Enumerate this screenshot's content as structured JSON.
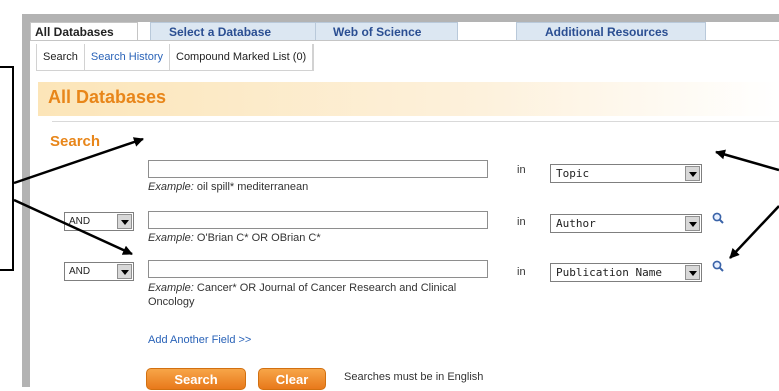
{
  "tabs": [
    {
      "label": "All Databases"
    },
    {
      "label": "Select a Database"
    },
    {
      "label": "Web of Science"
    },
    {
      "label": "Additional Resources"
    }
  ],
  "subnav": {
    "search": "Search",
    "history": "Search History",
    "marked": "Compound Marked List (0)"
  },
  "page_title": "All Databases",
  "search_heading": "Search",
  "rows": [
    {
      "operator": "",
      "value": "",
      "example_label": "Example:",
      "example_text": " oil spill* mediterranean",
      "in": "in",
      "field": "Topic"
    },
    {
      "operator": "AND",
      "value": "",
      "example_label": "Example:",
      "example_text": " O'Brian C* OR OBrian C*",
      "in": "in",
      "field": "Author"
    },
    {
      "operator": "AND",
      "value": "",
      "example_label": "Example:",
      "example_text": " Cancer* OR Journal of Cancer Research and Clinical Oncology",
      "in": "in",
      "field": "Publication Name"
    }
  ],
  "add_field": "Add Another Field >>",
  "buttons": {
    "search": "Search",
    "clear": "Clear"
  },
  "note": "Searches must be in English",
  "colors": {
    "accent": "#e8861a",
    "link": "#2a63b8",
    "tab_bg": "#dce7f2"
  }
}
